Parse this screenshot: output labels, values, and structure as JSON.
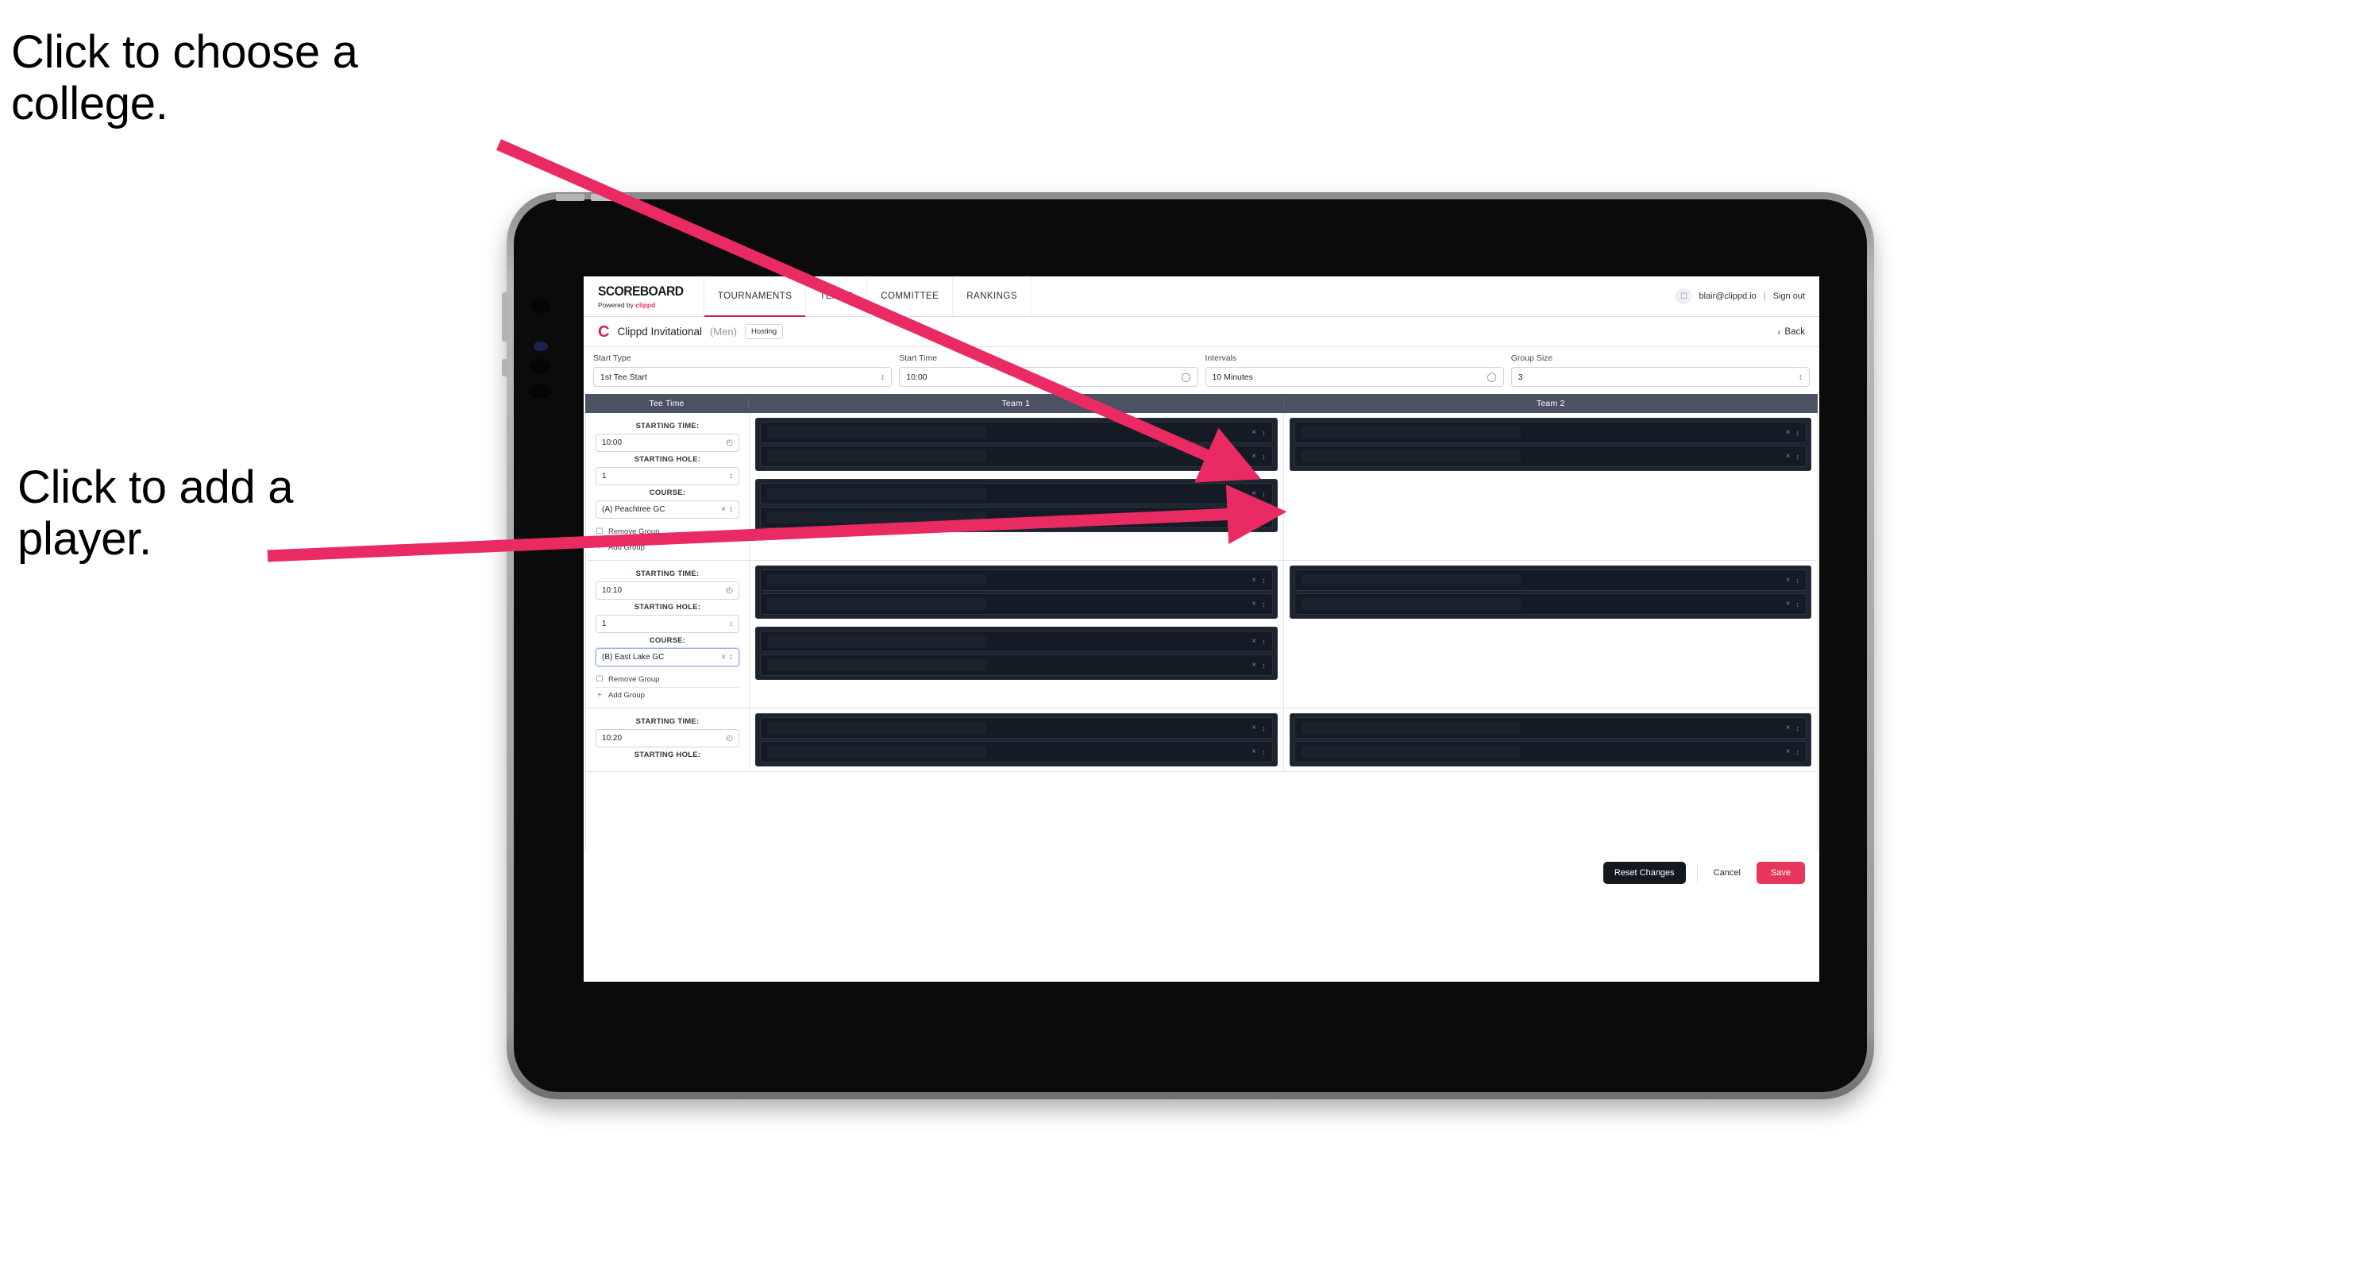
{
  "annotations": [
    {
      "id": "college",
      "text": "Click to choose a college."
    },
    {
      "id": "player",
      "text": "Click to add a player."
    }
  ],
  "brand": {
    "title": "SCOREBOARD",
    "powered_prefix": "Powered by ",
    "powered_name": "clippd"
  },
  "nav": {
    "tabs": [
      {
        "label": "TOURNAMENTS",
        "active": true
      },
      {
        "label": "TEAMS",
        "active": false
      },
      {
        "label": "COMMITTEE",
        "active": false
      },
      {
        "label": "RANKINGS",
        "active": false
      }
    ]
  },
  "user": {
    "avatar_icon": "user-icon",
    "email": "blair@clippd.io",
    "separator": "|",
    "sign_out": "Sign out"
  },
  "tournament": {
    "logo_letter": "C",
    "name": "Clippd Invitational",
    "gender": "(Men)",
    "badge": "Hosting",
    "back_chevron": "‹",
    "back_label": "Back"
  },
  "controls": [
    {
      "label": "Start Type",
      "value": "1st Tee Start",
      "icon": "stepper-icon"
    },
    {
      "label": "Start Time",
      "value": "10:00",
      "icon": "clock-icon"
    },
    {
      "label": "Intervals",
      "value": "10 Minutes",
      "icon": "clock-icon"
    },
    {
      "label": "Group Size",
      "value": "3",
      "icon": "stepper-icon"
    }
  ],
  "table": {
    "headers": {
      "tee_time": "Tee Time",
      "team_1": "Team 1",
      "team_2": "Team 2"
    },
    "field_labels": {
      "starting_time": "STARTING TIME:",
      "starting_hole": "STARTING HOLE:",
      "course": "COURSE:"
    },
    "actions": {
      "remove_group": "Remove Group",
      "remove_icon": "trash-icon",
      "add_group": "Add Group",
      "add_icon": "plus-icon"
    },
    "slot_icons": {
      "clear": "×",
      "stepper": "↕"
    },
    "rows": [
      {
        "starting_time": "10:00",
        "starting_hole": "1",
        "course": "(A) Peachtree GC",
        "course_focused": false,
        "team_1_groups": [
          2,
          2
        ],
        "team_2_groups": [
          2
        ]
      },
      {
        "starting_time": "10:10",
        "starting_hole": "1",
        "course": "(B) East Lake GC",
        "course_focused": true,
        "team_1_groups": [
          2,
          2
        ],
        "team_2_groups": [
          2
        ]
      },
      {
        "starting_time": "10:20",
        "starting_hole": "",
        "course": "",
        "course_focused": false,
        "team_1_groups": [
          2
        ],
        "team_2_groups": [
          2
        ],
        "partial": true
      }
    ]
  },
  "footer": {
    "reset": "Reset Changes",
    "cancel": "Cancel",
    "save": "Save"
  },
  "colors": {
    "accent_pink": "#e8375c",
    "brand_red": "#d8234c",
    "table_header": "#4b5262",
    "slot_dark": "#1d2430",
    "annotation_arrow": "#ea2b63"
  }
}
